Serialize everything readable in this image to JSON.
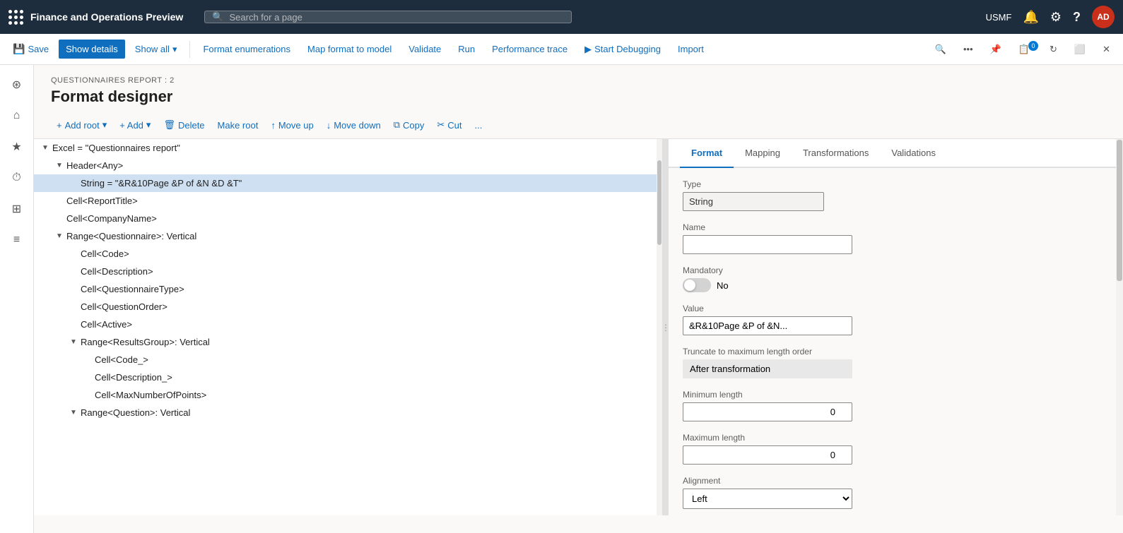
{
  "topbar": {
    "app_name": "Finance and Operations Preview",
    "search_placeholder": "Search for a page",
    "username": "USMF",
    "avatar_initials": "AD"
  },
  "command_bar": {
    "save_label": "Save",
    "show_details_label": "Show details",
    "show_all_label": "Show all",
    "format_enumerations_label": "Format enumerations",
    "map_format_label": "Map format to model",
    "validate_label": "Validate",
    "run_label": "Run",
    "performance_trace_label": "Performance trace",
    "start_debugging_label": "Start Debugging",
    "import_label": "Import"
  },
  "page_header": {
    "breadcrumb": "QUESTIONNAIRES REPORT : 2",
    "title": "Format designer"
  },
  "format_toolbar": {
    "add_root_label": "Add root",
    "add_label": "+ Add",
    "delete_label": "Delete",
    "make_root_label": "Make root",
    "move_up_label": "Move up",
    "move_down_label": "Move down",
    "copy_label": "Copy",
    "cut_label": "Cut",
    "more_label": "..."
  },
  "tabs": {
    "format_label": "Format",
    "mapping_label": "Mapping",
    "transformations_label": "Transformations",
    "validations_label": "Validations"
  },
  "tree": {
    "items": [
      {
        "indent": 0,
        "arrow": "▼",
        "text": "Excel = \"Questionnaires report\"",
        "level": 0
      },
      {
        "indent": 1,
        "arrow": "▼",
        "text": "Header<Any>",
        "level": 1
      },
      {
        "indent": 2,
        "arrow": "",
        "text": "String = \"&R&10Page &P of &N &D &T\"",
        "level": 2,
        "selected": true
      },
      {
        "indent": 1,
        "arrow": "",
        "text": "Cell<ReportTitle>",
        "level": 1
      },
      {
        "indent": 1,
        "arrow": "",
        "text": "Cell<CompanyName>",
        "level": 1
      },
      {
        "indent": 1,
        "arrow": "▼",
        "text": "Range<Questionnaire>: Vertical",
        "level": 1
      },
      {
        "indent": 2,
        "arrow": "",
        "text": "Cell<Code>",
        "level": 2
      },
      {
        "indent": 2,
        "arrow": "",
        "text": "Cell<Description>",
        "level": 2
      },
      {
        "indent": 2,
        "arrow": "",
        "text": "Cell<QuestionnaireType>",
        "level": 2
      },
      {
        "indent": 2,
        "arrow": "",
        "text": "Cell<QuestionOrder>",
        "level": 2
      },
      {
        "indent": 2,
        "arrow": "",
        "text": "Cell<Active>",
        "level": 2
      },
      {
        "indent": 2,
        "arrow": "▼",
        "text": "Range<ResultsGroup>: Vertical",
        "level": 2
      },
      {
        "indent": 3,
        "arrow": "",
        "text": "Cell<Code_>",
        "level": 3
      },
      {
        "indent": 3,
        "arrow": "",
        "text": "Cell<Description_>",
        "level": 3
      },
      {
        "indent": 3,
        "arrow": "",
        "text": "Cell<MaxNumberOfPoints>",
        "level": 3
      },
      {
        "indent": 2,
        "arrow": "▼",
        "text": "Range<Question>: Vertical",
        "level": 2
      }
    ]
  },
  "form": {
    "type_label": "Type",
    "type_value": "String",
    "name_label": "Name",
    "name_value": "",
    "mandatory_label": "Mandatory",
    "mandatory_value": "No",
    "value_label": "Value",
    "value_value": "&R&10Page &P of &N...",
    "truncate_label": "Truncate to maximum length order",
    "truncate_value": "After transformation",
    "min_length_label": "Minimum length",
    "min_length_value": "0",
    "max_length_label": "Maximum length",
    "max_length_value": "0",
    "alignment_label": "Alignment",
    "alignment_value": "Left"
  },
  "sidebar": {
    "items": [
      {
        "icon": "☰",
        "name": "menu-icon"
      },
      {
        "icon": "⌂",
        "name": "home-icon"
      },
      {
        "icon": "★",
        "name": "favorites-icon"
      },
      {
        "icon": "⏱",
        "name": "recent-icon"
      },
      {
        "icon": "⊞",
        "name": "workspaces-icon"
      },
      {
        "icon": "≡",
        "name": "list-icon"
      }
    ]
  }
}
